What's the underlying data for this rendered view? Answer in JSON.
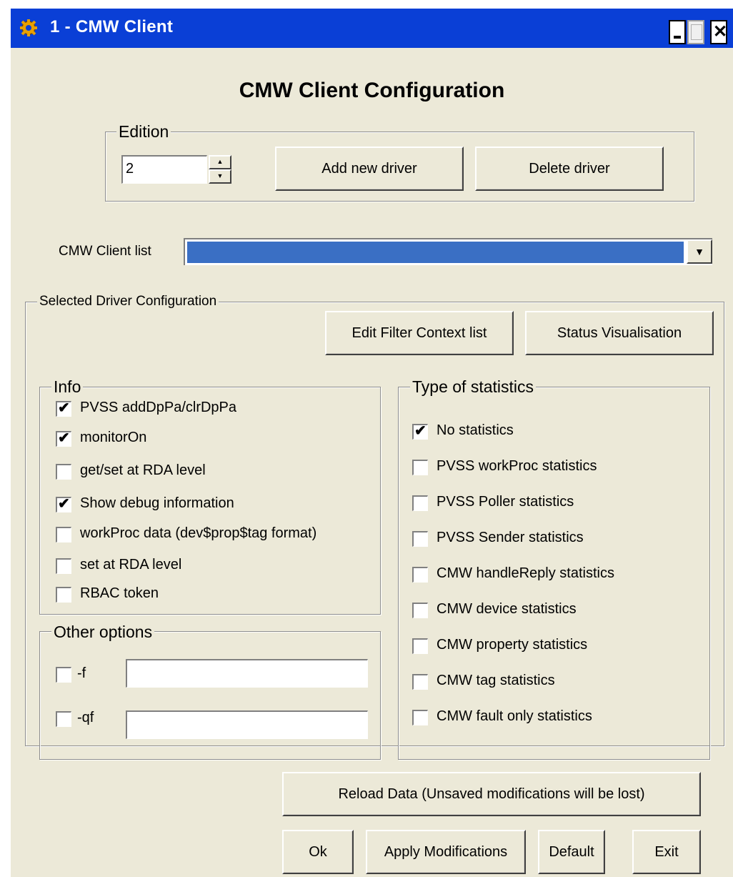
{
  "window": {
    "title": "1 - CMW Client",
    "icon": "gear-icon",
    "controls": {
      "minimize": "minimize-icon",
      "maximize": "maximize-icon",
      "close": "close-icon"
    }
  },
  "heading": "CMW Client Configuration",
  "edition": {
    "legend": "Edition",
    "value": "2",
    "add_button": "Add new driver",
    "delete_button": "Delete driver"
  },
  "client_list": {
    "label": "CMW Client list",
    "selected": ""
  },
  "selected_driver": {
    "legend": "Selected Driver Configuration",
    "edit_filter_button": "Edit Filter Context list",
    "status_button": "Status Visualisation"
  },
  "info": {
    "legend": "Info",
    "items": [
      {
        "label": "PVSS addDpPa/clrDpPa",
        "checked": true
      },
      {
        "label": "monitorOn",
        "checked": true
      },
      {
        "label": "get/set at RDA level",
        "checked": false
      },
      {
        "label": "Show debug information",
        "checked": true
      },
      {
        "label": "workProc data (dev$prop$tag format)",
        "checked": false
      },
      {
        "label": "set at RDA level",
        "checked": false
      },
      {
        "label": "RBAC token",
        "checked": false
      }
    ]
  },
  "other_options": {
    "legend": "Other options",
    "items": [
      {
        "label": "-f",
        "checked": false,
        "value": ""
      },
      {
        "label": "-qf",
        "checked": false,
        "value": ""
      }
    ]
  },
  "statistics": {
    "legend": "Type of statistics",
    "items": [
      {
        "label": "No statistics",
        "checked": true
      },
      {
        "label": "PVSS workProc statistics",
        "checked": false
      },
      {
        "label": "PVSS Poller statistics",
        "checked": false
      },
      {
        "label": "PVSS Sender statistics",
        "checked": false
      },
      {
        "label": "CMW handleReply statistics",
        "checked": false
      },
      {
        "label": "CMW device statistics",
        "checked": false
      },
      {
        "label": "CMW property statistics",
        "checked": false
      },
      {
        "label": "CMW tag statistics",
        "checked": false
      },
      {
        "label": "CMW fault only statistics",
        "checked": false
      }
    ]
  },
  "footer": {
    "reload": "Reload Data (Unsaved modifications will be lost)",
    "ok": "Ok",
    "apply": "Apply Modifications",
    "default": "Default",
    "exit": "Exit"
  },
  "colors": {
    "titlebar": "#0a3fd6",
    "window_bg": "#ece9d8",
    "selection": "#3a6fc4",
    "title_icon": "#e8a000"
  }
}
